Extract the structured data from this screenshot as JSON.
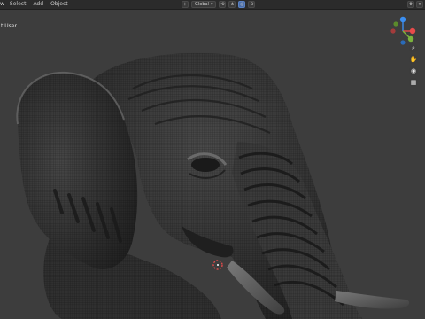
{
  "header": {
    "menu": [
      {
        "label": "w",
        "name": "menu-view"
      },
      {
        "label": "Select",
        "name": "menu-select"
      },
      {
        "label": "Add",
        "name": "menu-add"
      },
      {
        "label": "Object",
        "name": "menu-object"
      }
    ],
    "orientation_label": "Global"
  },
  "viewport": {
    "mode_label": "t.User"
  },
  "gizmo": {
    "axis_z": "Z",
    "axis_y": "Y",
    "axis_x": "X"
  },
  "colors": {
    "background": "#3d3d3d",
    "header": "#2b2b2b",
    "x_axis": "#e84b4b",
    "y_axis": "#7bb33c",
    "z_axis": "#3b8ef0",
    "mesh": "#2a2a2a"
  }
}
